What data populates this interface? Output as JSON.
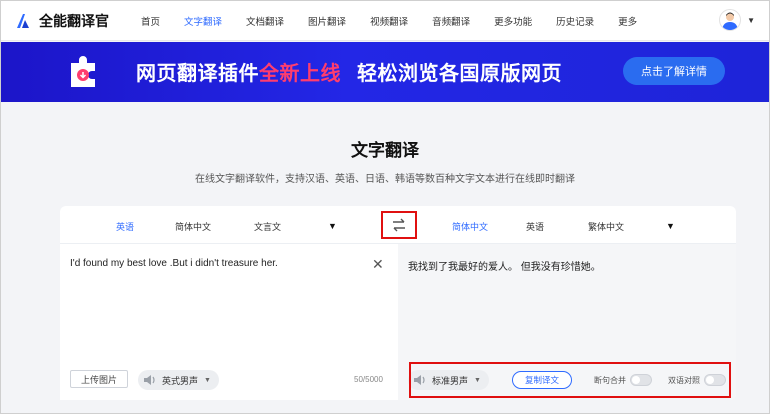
{
  "app": {
    "name": "全能翻译官"
  },
  "nav": {
    "items": [
      {
        "label": "首页",
        "active": false
      },
      {
        "label": "文字翻译",
        "active": true
      },
      {
        "label": "文档翻译",
        "active": false
      },
      {
        "label": "图片翻译",
        "active": false
      },
      {
        "label": "视频翻译",
        "active": false
      },
      {
        "label": "音频翻译",
        "active": false
      },
      {
        "label": "更多功能",
        "active": false
      },
      {
        "label": "历史记录",
        "active": false
      },
      {
        "label": "更多",
        "active": false
      }
    ]
  },
  "banner": {
    "text_part1": "网页翻译插件",
    "text_highlight": "全新上线",
    "text_part2": "轻松浏览各国原版网页",
    "button_label": "点击了解详情",
    "highlight_color": "#ff3d6e"
  },
  "page": {
    "title": "文字翻译",
    "subtitle": "在线文字翻译软件，支持汉语、英语、日语、韩语等数百种文字文本进行在线即时翻译"
  },
  "source_langs": [
    "英语",
    "简体中文",
    "文言文"
  ],
  "source_active": "英语",
  "target_langs": [
    "简体中文",
    "英语",
    "繁体中文"
  ],
  "target_active": "简体中文",
  "source": {
    "text": "I'd found my best love .But i didn't treasure her.",
    "upload_label": "上传图片",
    "voice_label": "英式男声",
    "char_count": "50/5000"
  },
  "target": {
    "text": "我找到了我最好的爱人。 但我没有珍惜她。",
    "voice_label": "标准男声",
    "copy_label": "复制译文",
    "toggle1_label": "断句合并",
    "toggle2_label": "双语对照"
  },
  "colors": {
    "accent": "#2f6bff",
    "banner_bg": "#1b1ed8",
    "highlight_border": "#e01010"
  }
}
